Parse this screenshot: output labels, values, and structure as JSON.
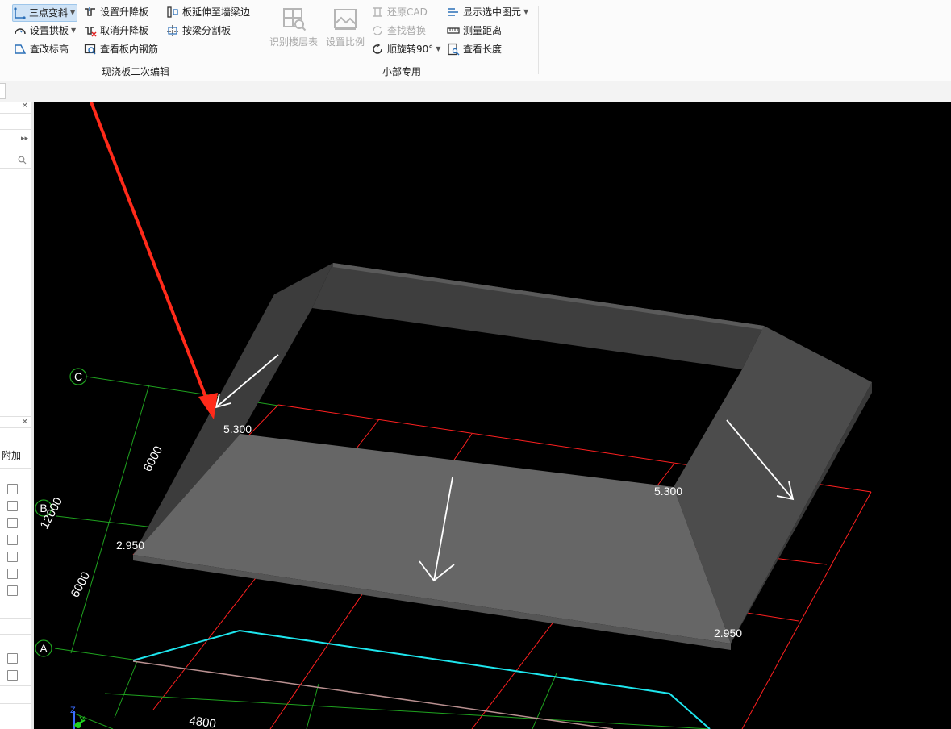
{
  "ribbon": {
    "group1": {
      "label": "现浇板二次编辑",
      "items": {
        "three_point_slope": "三点变斜",
        "set_arch_slab": "设置拱板",
        "check_elevation": "查改标高",
        "set_raise_lower": "设置升降板",
        "cancel_raise_lower": "取消升降板",
        "view_rebar": "查看板内钢筋",
        "extend_to_wall_beam": "板延伸至墙梁边",
        "split_by_beam": "按梁分割板"
      }
    },
    "group2": {
      "label": "小部专用",
      "items": {
        "identify_floor_table": "识别楼层表",
        "set_scale": "设置比例",
        "restore_cad": "还原CAD",
        "find_replace": "查找替换",
        "rotate_90": "顺旋转90°",
        "show_selected": "显示选中图元",
        "measure_distance": "测量距离",
        "view_length": "查看长度"
      }
    }
  },
  "left_panel": {
    "column_header": "附加"
  },
  "viewport": {
    "axis_labels": {
      "c": "C",
      "b": "B",
      "a": "A"
    },
    "dimensions": {
      "d1": "6000",
      "d2": "12000",
      "d3": "6000",
      "d4": "4800"
    },
    "elevations": {
      "e1": "5.300",
      "e2": "2.950",
      "e3": "5.300",
      "e4": "2.950"
    },
    "coord_axes": {
      "z": "Z",
      "y": "Y"
    }
  },
  "colors": {
    "viewport_bg": "#000000",
    "slab_front": "#656565",
    "slab_side": "#4a4a4a",
    "slab_back": "#3e3e3e",
    "grid_red": "#ff2020",
    "grid_green": "#1fa31f",
    "cyan_line": "#1ee6ee",
    "annotation_arrow": "#ff2a1a"
  }
}
